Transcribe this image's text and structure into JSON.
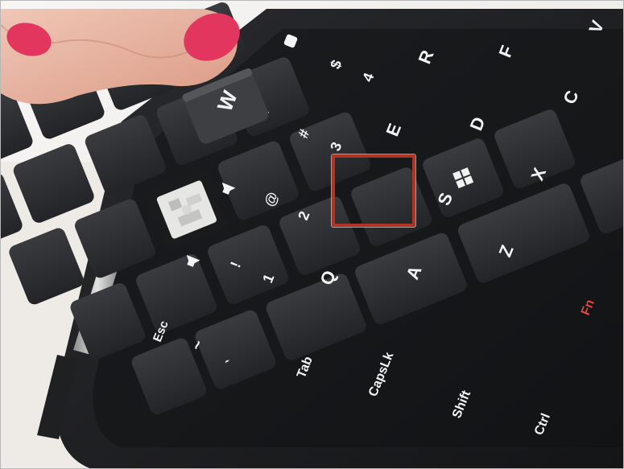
{
  "keys": {
    "esc": "Esc",
    "tab": "Tab",
    "capslock": "CapsLk",
    "shift": "Shift",
    "ctrl": "Ctrl",
    "fn": "Fn",
    "q": "Q",
    "a": "A",
    "z": "Z",
    "s": "S",
    "x": "X",
    "d": "D",
    "c": "C",
    "e": "E",
    "r": "R",
    "f": "F",
    "v": "V",
    "w": "W",
    "one": "1",
    "one_shift": "!",
    "two": "2",
    "two_shift": "@",
    "three": "3",
    "three_shift": "#",
    "four": "4",
    "four_shift": "$",
    "tilde": "~",
    "tilde_lower": "`"
  },
  "colors": {
    "highlight": "#b03423",
    "fn_label": "#e0473a",
    "key_body": "#2b2c2f",
    "chassis": "#1b1c1e",
    "skin": "#e9b3a0",
    "nail": "#e2365e"
  }
}
